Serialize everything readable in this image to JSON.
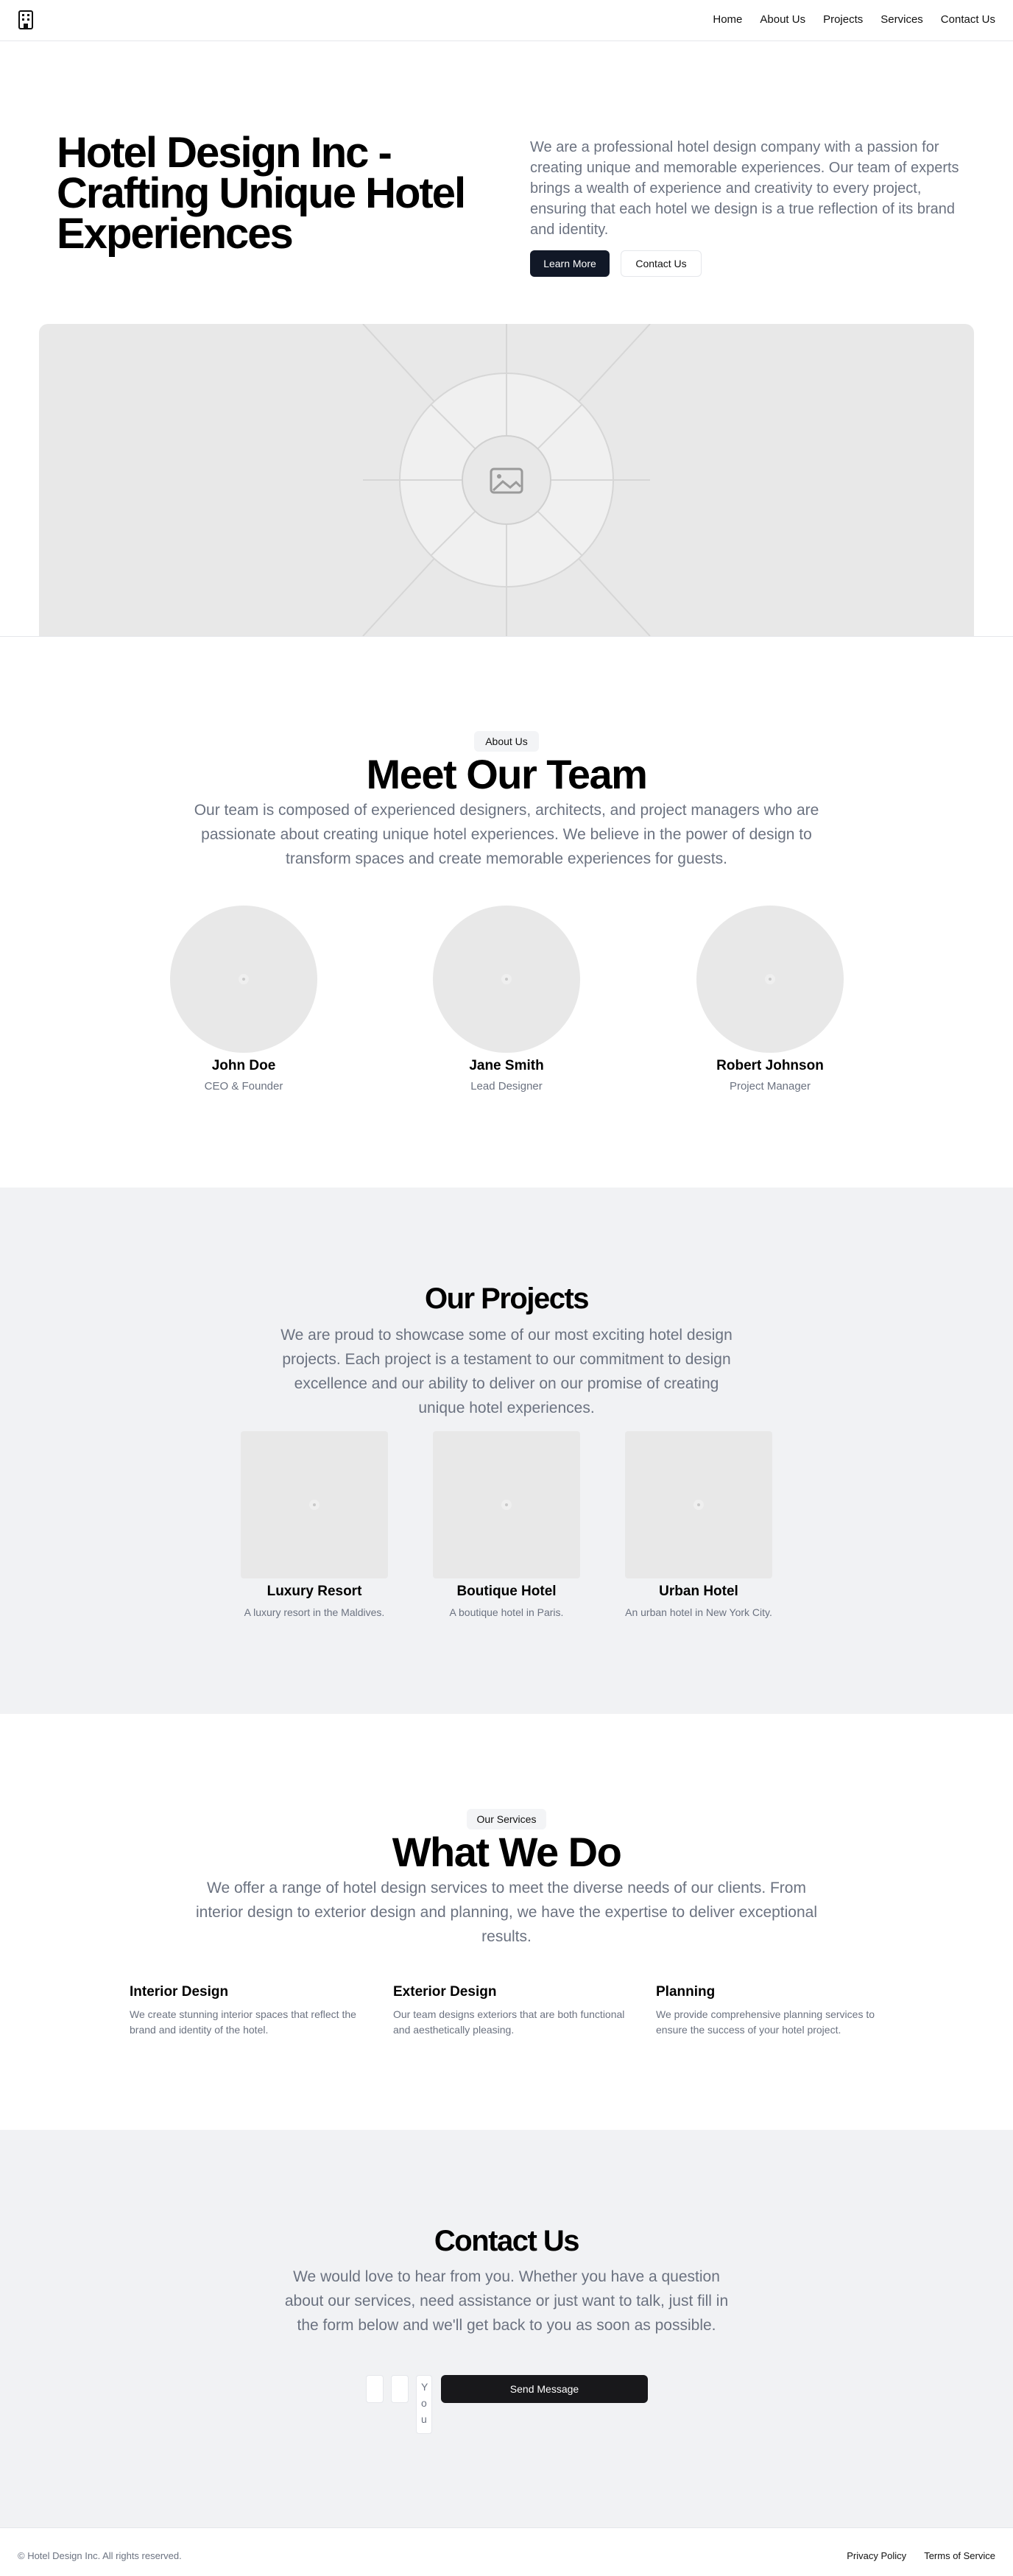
{
  "nav": {
    "logo_icon": "building-icon",
    "items": [
      "Home",
      "About Us",
      "Projects",
      "Services",
      "Contact Us"
    ]
  },
  "hero": {
    "title": "Hotel Design Inc - Crafting Unique Hotel Experiences",
    "description": "We are a professional hotel design company with a passion for creating unique and memorable experiences. Our team of experts brings a wealth of experience and creativity to every project, ensuring that each hotel we design is a true reflection of its brand and identity.",
    "learn_more": "Learn More",
    "contact": "Contact Us",
    "image_icon": "image-placeholder-icon"
  },
  "about": {
    "badge": "About Us",
    "title": "Meet Our Team",
    "description": "Our team is composed of experienced designers, architects, and project managers who are passionate about creating unique hotel experiences. We believe in the power of design to transform spaces and create memorable experiences for guests.",
    "members": [
      {
        "name": "John Doe",
        "role": "CEO & Founder"
      },
      {
        "name": "Jane Smith",
        "role": "Lead Designer"
      },
      {
        "name": "Robert Johnson",
        "role": "Project Manager"
      }
    ]
  },
  "projects": {
    "title": "Our Projects",
    "description": "We are proud to showcase some of our most exciting hotel design projects. Each project is a testament to our commitment to design excellence and our ability to deliver on our promise of creating unique hotel experiences.",
    "items": [
      {
        "name": "Luxury Resort",
        "desc": "A luxury resort in the Maldives."
      },
      {
        "name": "Boutique Hotel",
        "desc": "A boutique hotel in Paris."
      },
      {
        "name": "Urban Hotel",
        "desc": "An urban hotel in New York City."
      }
    ]
  },
  "services": {
    "badge": "Our Services",
    "title": "What We Do",
    "description": "We offer a range of hotel design services to meet the diverse needs of our clients. From interior design to exterior design and planning, we have the expertise to deliver exceptional results.",
    "items": [
      {
        "title": "Interior Design",
        "desc": "We create stunning interior spaces that reflect the brand and identity of the hotel."
      },
      {
        "title": "Exterior Design",
        "desc": "Our team designs exteriors that are both functional and aesthetically pleasing."
      },
      {
        "title": "Planning",
        "desc": "We provide comprehensive planning services to ensure the success of your hotel project."
      }
    ]
  },
  "contact": {
    "title": "Contact Us",
    "description": "We would love to hear from you. Whether you have a question about our services, need assistance or just want to talk, just fill in the form below and we'll get back to you as soon as possible.",
    "message_visible_text": "You",
    "send_label": "Send Message"
  },
  "footer": {
    "copyright": "© Hotel Design Inc. All rights reserved.",
    "links": [
      "Privacy Policy",
      "Terms of Service"
    ]
  }
}
